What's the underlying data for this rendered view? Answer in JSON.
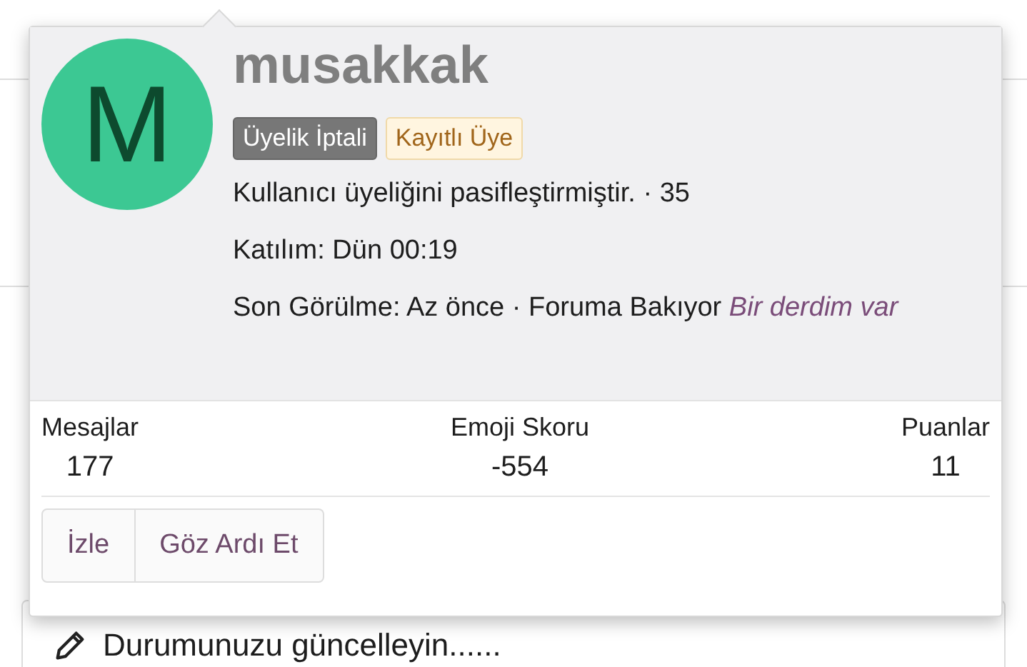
{
  "page": {
    "status_prompt": "Durumunuzu güncelleyin......"
  },
  "member_card": {
    "avatar_letter": "M",
    "username": "musakkak",
    "badges": [
      {
        "label": "Üyelik İptali",
        "kind": "banned"
      },
      {
        "label": "Kayıtlı Üye",
        "kind": "registered"
      }
    ],
    "info_lines": [
      "Kullanıcı üyeliğini pasifleştirmiştir. · 35",
      "Katılım: Dün 00:19",
      "Son Görülme: Az önce · Foruma Bakıyor *Bir derdim var*"
    ],
    "stats": [
      {
        "label": "Mesajlar",
        "value": "177"
      },
      {
        "label": "Emoji Skoru",
        "value": "-554"
      },
      {
        "label": "Puanlar",
        "value": "11"
      }
    ],
    "buttons": [
      "İzle",
      "Göz Ardı Et"
    ]
  }
}
